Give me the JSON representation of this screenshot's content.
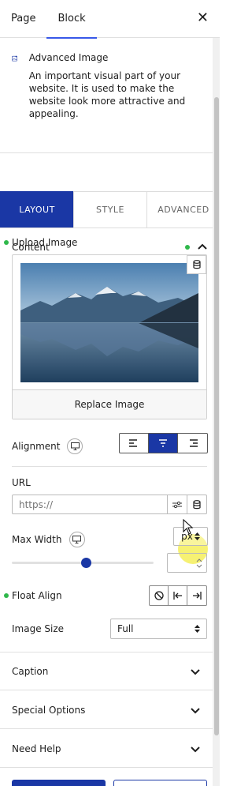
{
  "top_tabs": [
    {
      "label": "Page"
    },
    {
      "label": "Block"
    }
  ],
  "block": {
    "name": "Advanced Image",
    "description": "An important visual part of your website. It is used to make the website look more attractive and appealing."
  },
  "main_tabs": [
    {
      "label": "LAYOUT"
    },
    {
      "label": "STYLE"
    },
    {
      "label": "ADVANCED"
    }
  ],
  "content_panel": {
    "title": "Content"
  },
  "upload": {
    "label": "Upload Image",
    "replace_label": "Replace Image"
  },
  "alignment": {
    "label": "Alignment",
    "selected": "center"
  },
  "url": {
    "label": "URL",
    "placeholder": "https://"
  },
  "max_width": {
    "label": "Max Width",
    "unit": "px",
    "value": ""
  },
  "float_align": {
    "label": "Float Align"
  },
  "image_size": {
    "label": "Image Size",
    "value": "Full"
  },
  "collapsed_panels": [
    {
      "title": "Caption"
    },
    {
      "title": "Special Options"
    },
    {
      "title": "Need Help"
    }
  ],
  "colors": {
    "accent": "#1a37a5",
    "active_dot": "#2fb84b",
    "highlight": "#f5ef5a"
  }
}
